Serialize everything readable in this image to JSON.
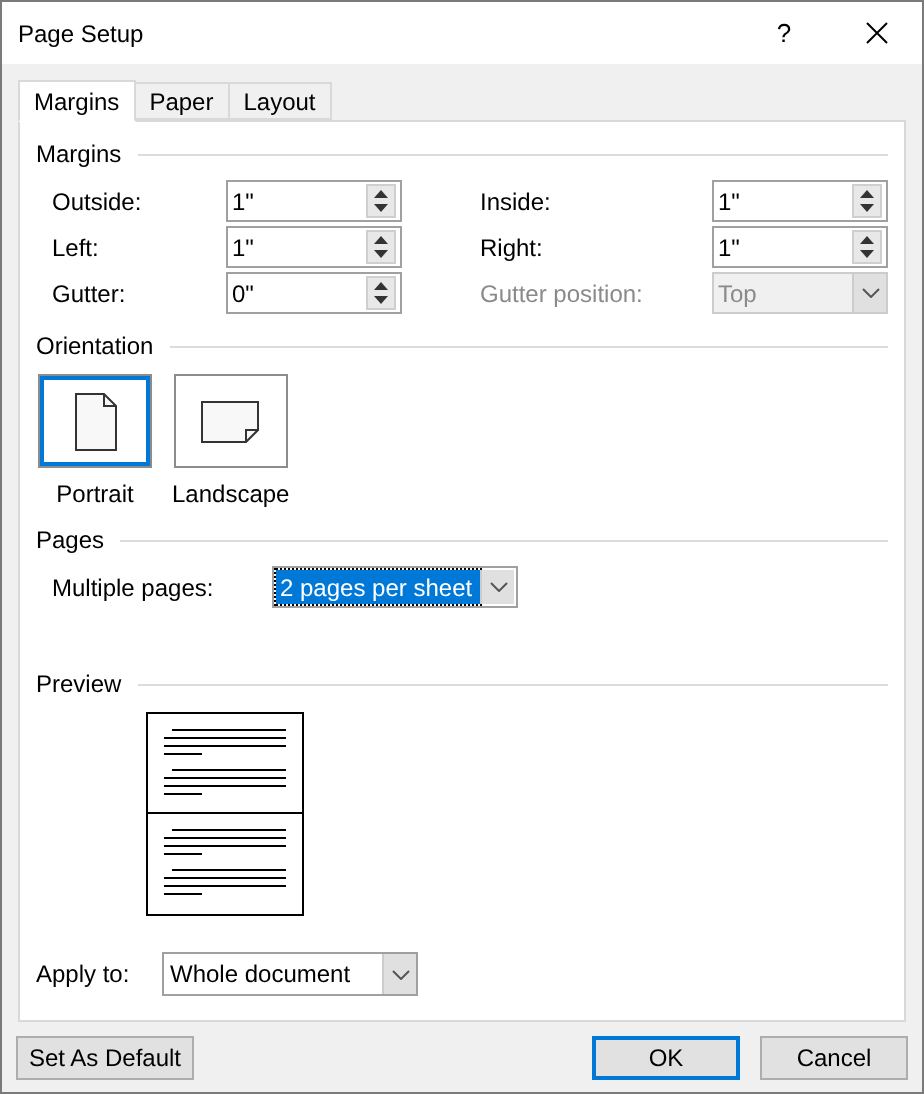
{
  "window": {
    "title": "Page Setup",
    "help": "?"
  },
  "tabs": [
    {
      "label": "Margins",
      "selected": true
    },
    {
      "label": "Paper",
      "selected": false
    },
    {
      "label": "Layout",
      "selected": false
    }
  ],
  "margins": {
    "heading": "Margins",
    "fields": [
      {
        "label": "Outside:",
        "value": "1\"",
        "kind": "spin",
        "disabled": false
      },
      {
        "label": "Inside:",
        "value": "1\"",
        "kind": "spin",
        "disabled": false
      },
      {
        "label": "Left:",
        "value": "1\"",
        "kind": "spin",
        "disabled": false
      },
      {
        "label": "Right:",
        "value": "1\"",
        "kind": "spin",
        "disabled": false
      },
      {
        "label": "Gutter:",
        "value": "0\"",
        "kind": "spin",
        "disabled": false
      },
      {
        "label": "Gutter position:",
        "value": "Top",
        "kind": "dropdown",
        "disabled": true
      }
    ]
  },
  "orientation": {
    "heading": "Orientation",
    "options": [
      {
        "label": "Portrait",
        "kind": "portrait",
        "selected": true
      },
      {
        "label": "Landscape",
        "kind": "landscape",
        "selected": false
      }
    ]
  },
  "pages": {
    "heading": "Pages",
    "label": "Multiple pages:",
    "value": "2 pages per sheet",
    "focused": true
  },
  "preview": {
    "heading": "Preview"
  },
  "apply_to": {
    "label": "Apply to:",
    "value": "Whole document"
  },
  "buttons": [
    {
      "label": "Set As Default",
      "default": false
    },
    {
      "label": "OK",
      "default": true
    },
    {
      "label": "Cancel",
      "default": false
    }
  ]
}
